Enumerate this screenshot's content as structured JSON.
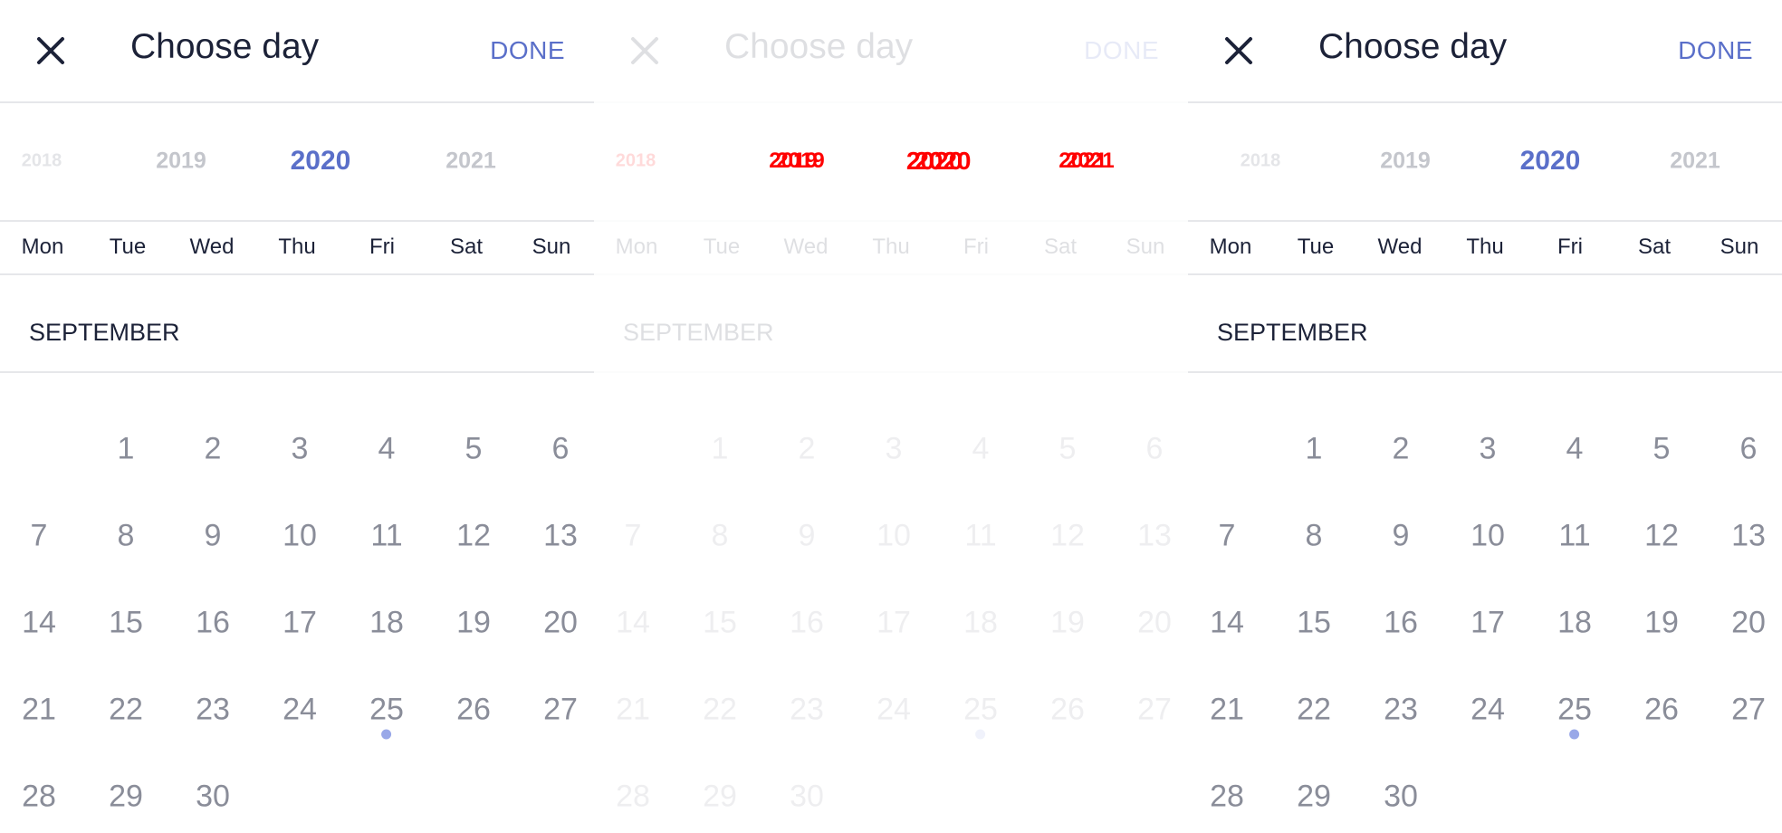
{
  "picker": {
    "title": "Choose day",
    "done_label": "DONE",
    "close_icon": "close-icon",
    "accent_color": "#5a6fc9",
    "years": [
      "2018",
      "2019",
      "2020",
      "2021"
    ],
    "selected_year": "2020",
    "weekdays": [
      "Mon",
      "Tue",
      "Wed",
      "Thu",
      "Fri",
      "Sat",
      "Sun"
    ],
    "month": "SEPTEMBER",
    "days": [
      "1",
      "2",
      "3",
      "4",
      "5",
      "6",
      "7",
      "8",
      "9",
      "10",
      "11",
      "12",
      "13",
      "14",
      "15",
      "16",
      "17",
      "18",
      "19",
      "20",
      "21",
      "22",
      "23",
      "24",
      "25",
      "26",
      "27",
      "28",
      "29",
      "30"
    ],
    "marked_day": "25"
  }
}
